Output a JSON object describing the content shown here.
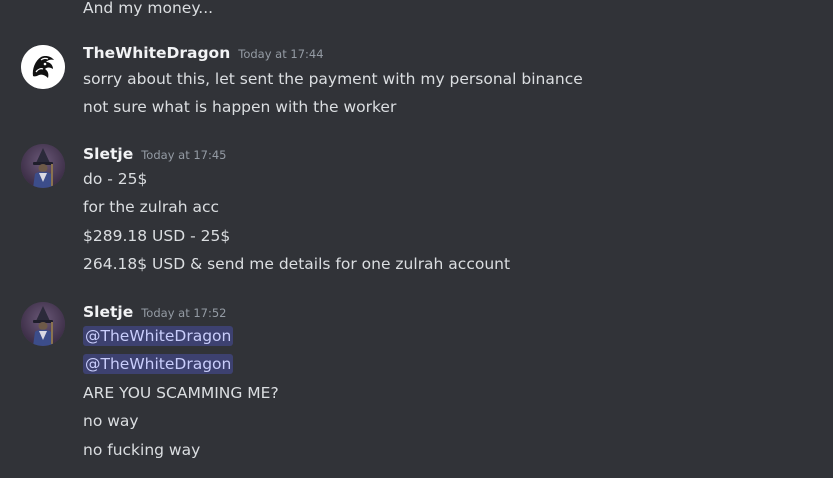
{
  "colors": {
    "background": "#313338",
    "text": "#dbdee1",
    "username": "#f2f3f5",
    "timestamp": "#949ba4",
    "mention_bg": "rgba(88,101,242,0.3)",
    "mention_text": "#c9cdfb"
  },
  "messages": [
    {
      "continuation": "And my money..."
    },
    {
      "username": "TheWhiteDragon",
      "timestamp": "Today at 17:44",
      "avatar": "white-dragon-avatar",
      "lines": [
        "sorry about this, let sent the payment with my personal binance",
        "not sure what is happen with the worker"
      ]
    },
    {
      "username": "Sletje",
      "timestamp": "Today at 17:45",
      "avatar": "wizard-avatar",
      "lines": [
        "do - 25$",
        "for the zulrah acc",
        "$289.18 USD  - 25$",
        "264.18$ USD & send me details for one zulrah account"
      ]
    },
    {
      "username": "Sletje",
      "timestamp": "Today at 17:52",
      "avatar": "wizard-avatar",
      "mentions": [
        "@TheWhiteDragon",
        "@TheWhiteDragon"
      ],
      "lines": [
        "ARE YOU SCAMMING ME?",
        "no way",
        "no fucking way"
      ]
    }
  ]
}
